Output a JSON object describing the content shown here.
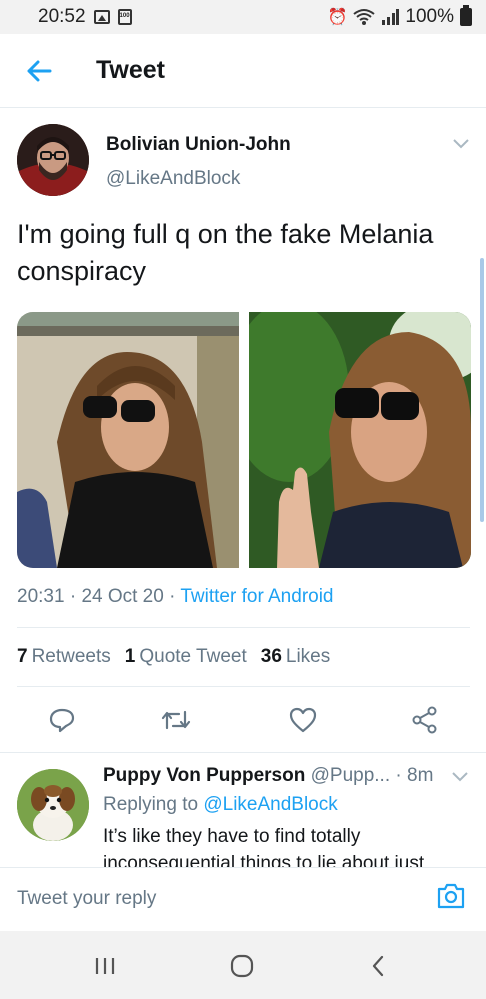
{
  "status_bar": {
    "time": "20:52",
    "battery_small": "100",
    "battery": "100%"
  },
  "header": {
    "title": "Tweet"
  },
  "tweet": {
    "author_name": "Bolivian Union-John",
    "author_handle": "@LikeAndBlock",
    "text": "I'm going full q on the fake Melania conspiracy",
    "time": "20:31",
    "date": "24 Oct 20",
    "source": "Twitter for Android",
    "retweets_count": "7",
    "retweets_label": "Retweets",
    "quotes_count": "1",
    "quotes_label": "Quote Tweet",
    "likes_count": "36",
    "likes_label": "Likes"
  },
  "reply": {
    "author_name": "Puppy Von Pupperson",
    "author_handle": "@Pupp...",
    "age": "8m",
    "replying_prefix": "Replying to",
    "replying_handle": "@LikeAndBlock",
    "text": "It’s like they have to find totally inconsequential things to lie about just"
  },
  "compose": {
    "placeholder": "Tweet your reply"
  },
  "colors": {
    "accent": "#1da1f2",
    "muted": "#657786",
    "text": "#14171a"
  },
  "icons": {
    "back": "arrow-left-icon",
    "reply": "speech-bubble-icon",
    "retweet": "retweet-icon",
    "like": "heart-icon",
    "share": "share-icon",
    "camera": "camera-icon",
    "nav_recents": "recents-icon",
    "nav_home": "home-icon",
    "nav_back": "back-chevron-icon"
  }
}
